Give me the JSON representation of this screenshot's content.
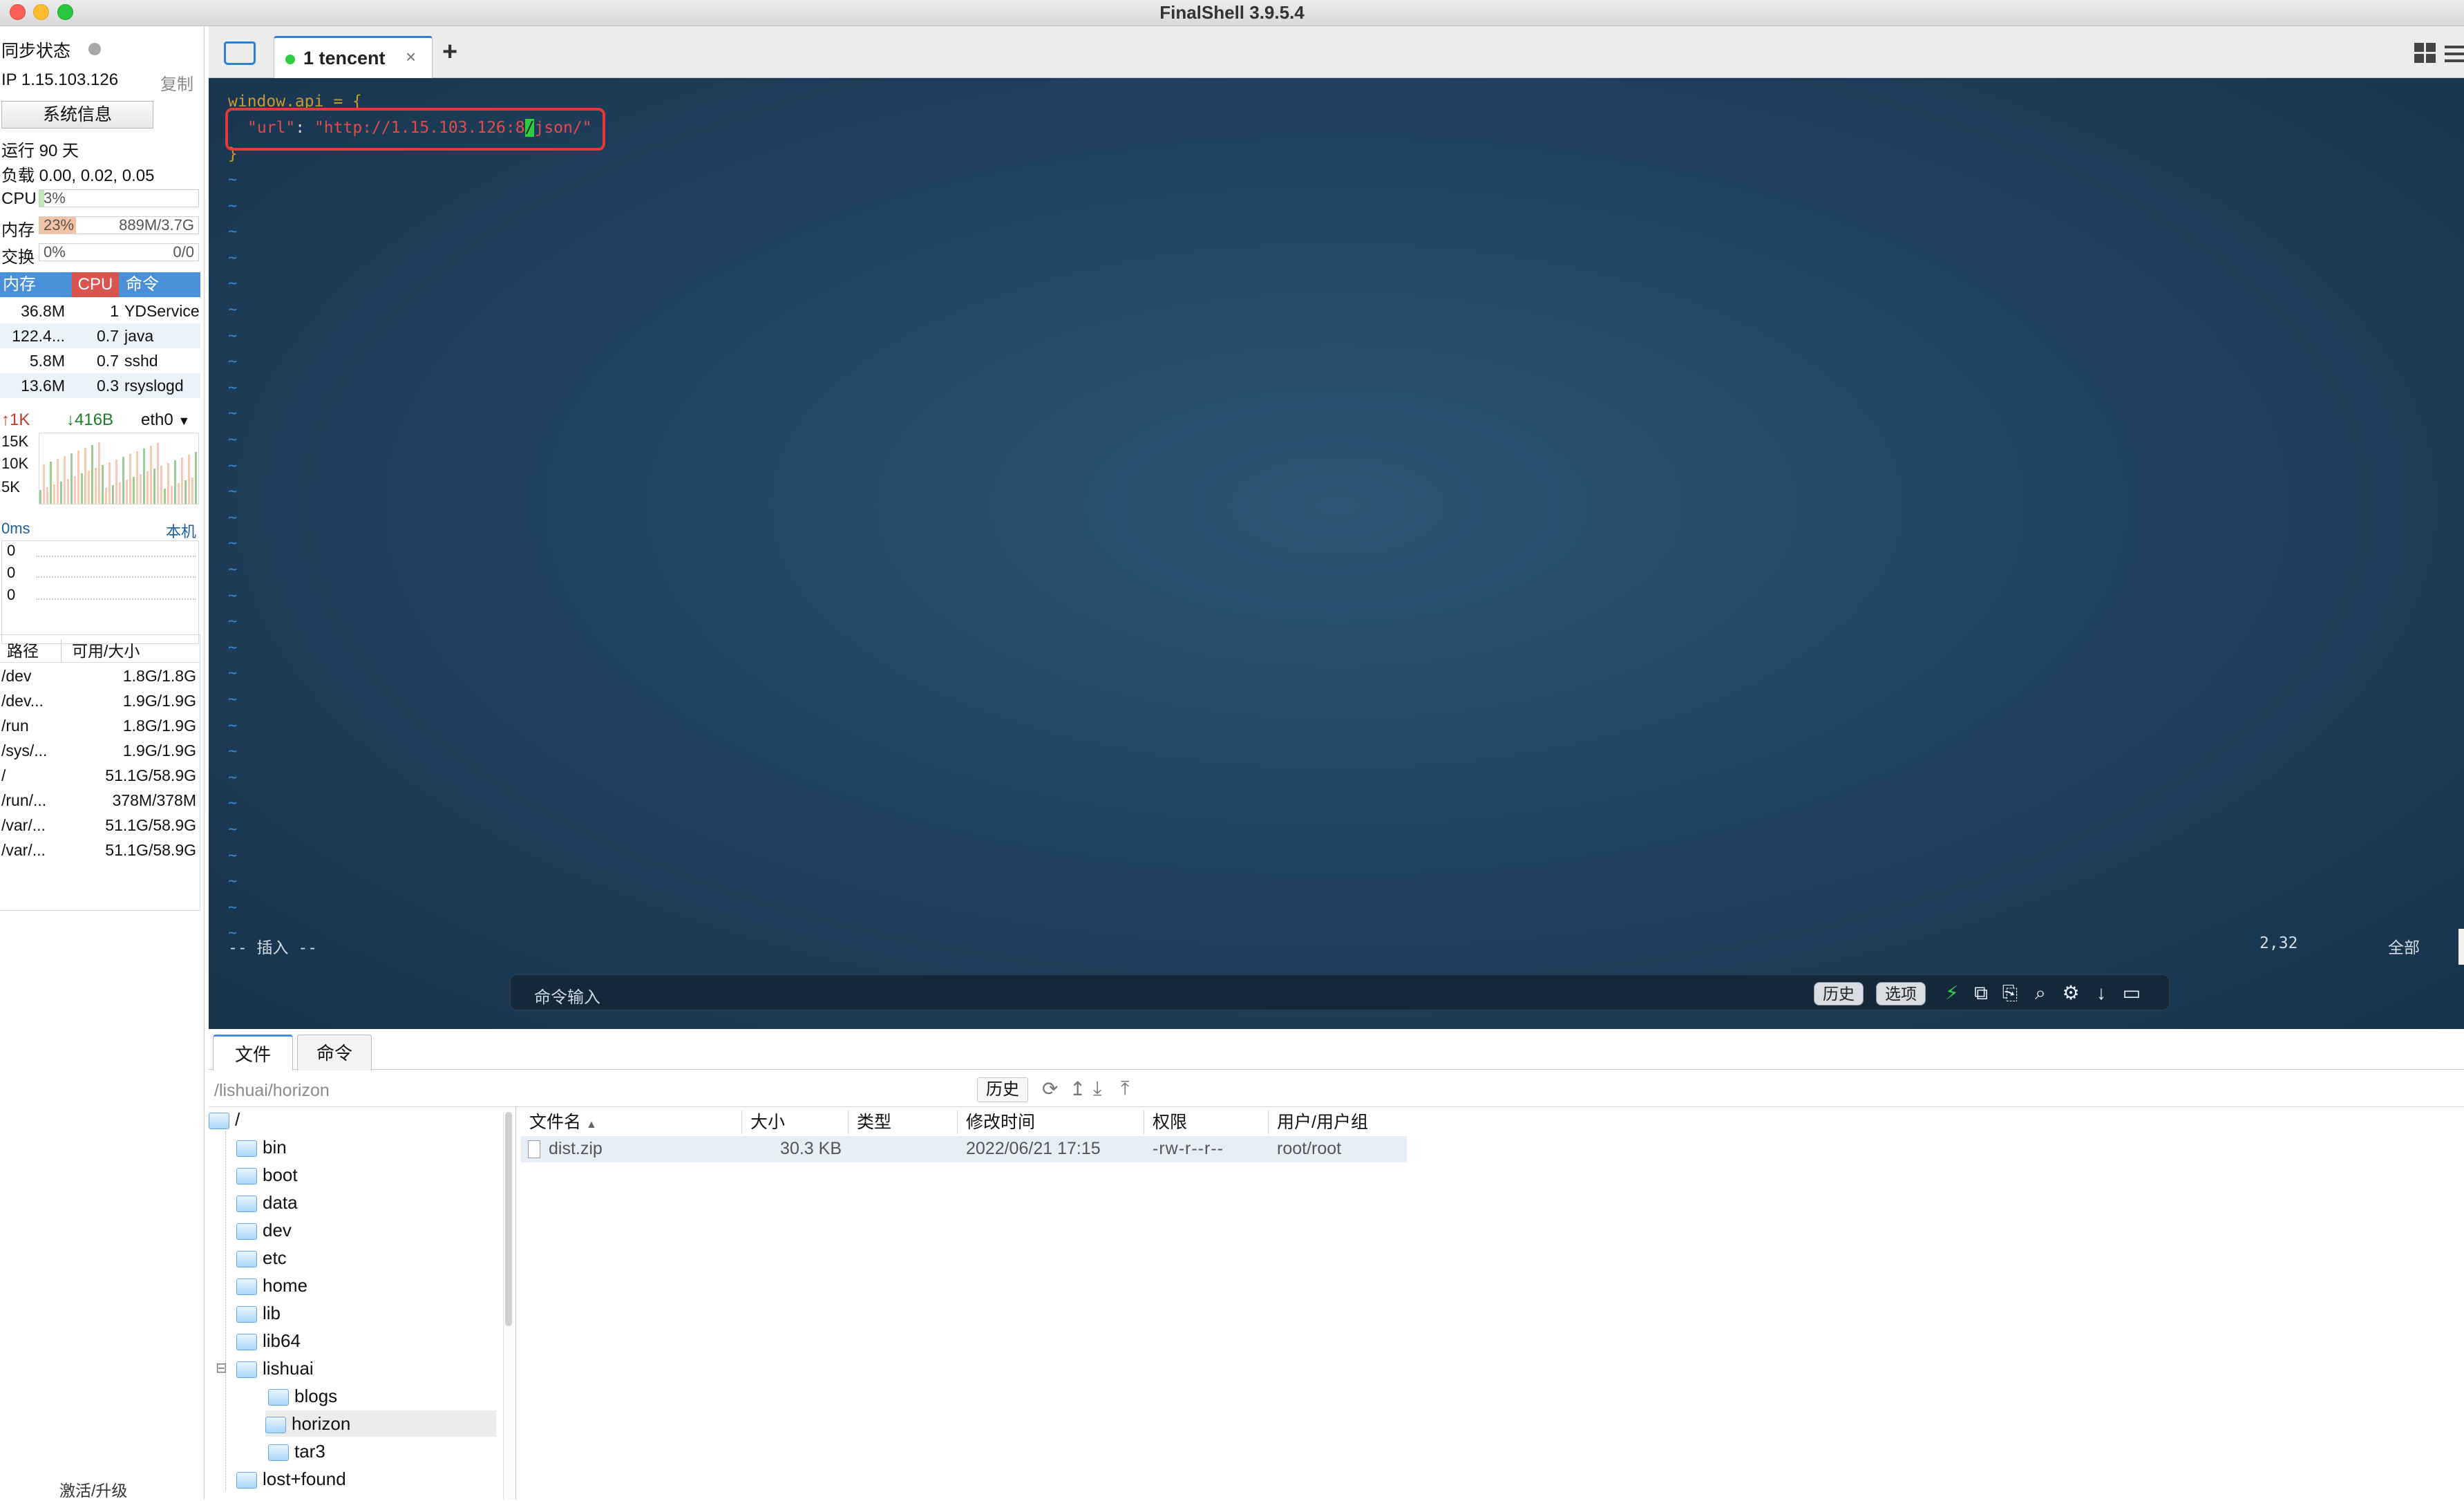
{
  "window": {
    "title": "FinalShell 3.9.5.4"
  },
  "sidebar": {
    "sync_label": "同步状态",
    "ip": "IP 1.15.103.126",
    "copy": "复制",
    "sysinfo_button": "系统信息",
    "uptime": "运行 90 天",
    "load": "负载 0.00, 0.02, 0.05",
    "cpu": {
      "label": "CPU",
      "value": "3%",
      "fraction": 0.03
    },
    "mem": {
      "label": "内存",
      "value": "23%",
      "fraction": 0.23,
      "size": "889M/3.7G"
    },
    "swap": {
      "label": "交换",
      "value": "0%",
      "size": "0/0"
    },
    "proc_headers": [
      "内存",
      "CPU",
      "命令"
    ],
    "processes": [
      {
        "mem": "36.8M",
        "cpu": "1",
        "cmd": "YDService"
      },
      {
        "mem": "122.4...",
        "cpu": "0.7",
        "cmd": "java"
      },
      {
        "mem": "5.8M",
        "cpu": "0.7",
        "cmd": "sshd"
      },
      {
        "mem": "13.6M",
        "cpu": "0.3",
        "cmd": "rsyslogd"
      }
    ],
    "net_up": "1K",
    "net_down": "416B",
    "net_iface": "eth0",
    "net_scale": [
      "15K",
      "10K",
      "5K"
    ],
    "ping": "0ms",
    "ping_host": "本机",
    "ping_vals": [
      "0",
      "0",
      "0"
    ],
    "disk_headers": [
      "路径",
      "可用/大小"
    ],
    "disks": [
      {
        "path": "/dev",
        "size": "1.8G/1.8G"
      },
      {
        "path": "/dev...",
        "size": "1.9G/1.9G"
      },
      {
        "path": "/run",
        "size": "1.8G/1.9G"
      },
      {
        "path": "/sys/...",
        "size": "1.9G/1.9G"
      },
      {
        "path": "/",
        "size": "51.1G/58.9G"
      },
      {
        "path": "/run/...",
        "size": "378M/378M"
      },
      {
        "path": "/var/...",
        "size": "51.1G/58.9G"
      },
      {
        "path": "/var/...",
        "size": "51.1G/58.9G"
      }
    ],
    "activate": "激活/升级"
  },
  "tabs": {
    "session": "1 tencent",
    "add": "+"
  },
  "terminal": {
    "line1": "window.api = {",
    "line2_key": "\"url\"",
    "line2_sep": ": ",
    "line2_val_a": "\"http://1.15.103.126:8",
    "line2_cursor": "/",
    "line2_val_b": "json/\"",
    "line3": "}",
    "tilde": "~",
    "mode": "-- 插入 --",
    "position": "2,32",
    "scroll": "全部"
  },
  "cmdbar": {
    "placeholder": "命令输入",
    "history": "历史",
    "options": "选项"
  },
  "bottom": {
    "tab_files": "文件",
    "tab_commands": "命令",
    "path": "/lishuai/horizon",
    "history": "历史",
    "tree": [
      {
        "name": "/",
        "level": 0
      },
      {
        "name": "bin",
        "level": 1
      },
      {
        "name": "boot",
        "level": 1
      },
      {
        "name": "data",
        "level": 1
      },
      {
        "name": "dev",
        "level": 1
      },
      {
        "name": "etc",
        "level": 1
      },
      {
        "name": "home",
        "level": 1
      },
      {
        "name": "lib",
        "level": 1
      },
      {
        "name": "lib64",
        "level": 1
      },
      {
        "name": "lishuai",
        "level": 1
      },
      {
        "name": "blogs",
        "level": 2
      },
      {
        "name": "horizon",
        "level": 2
      },
      {
        "name": "tar3",
        "level": 2
      },
      {
        "name": "lost+found",
        "level": 1
      }
    ],
    "columns": [
      "文件名",
      "大小",
      "类型",
      "修改时间",
      "权限",
      "用户/用户组"
    ],
    "files": [
      {
        "name": "dist.zip",
        "size": "30.3 KB",
        "type": "",
        "mtime": "2022/06/21 17:15",
        "perm": "-rw-r--r--",
        "owner": "root/root"
      }
    ]
  },
  "colors": {
    "accent": "#4a90d9",
    "terminal_bg": "#214463",
    "highlight_box": "#e03a3a"
  }
}
